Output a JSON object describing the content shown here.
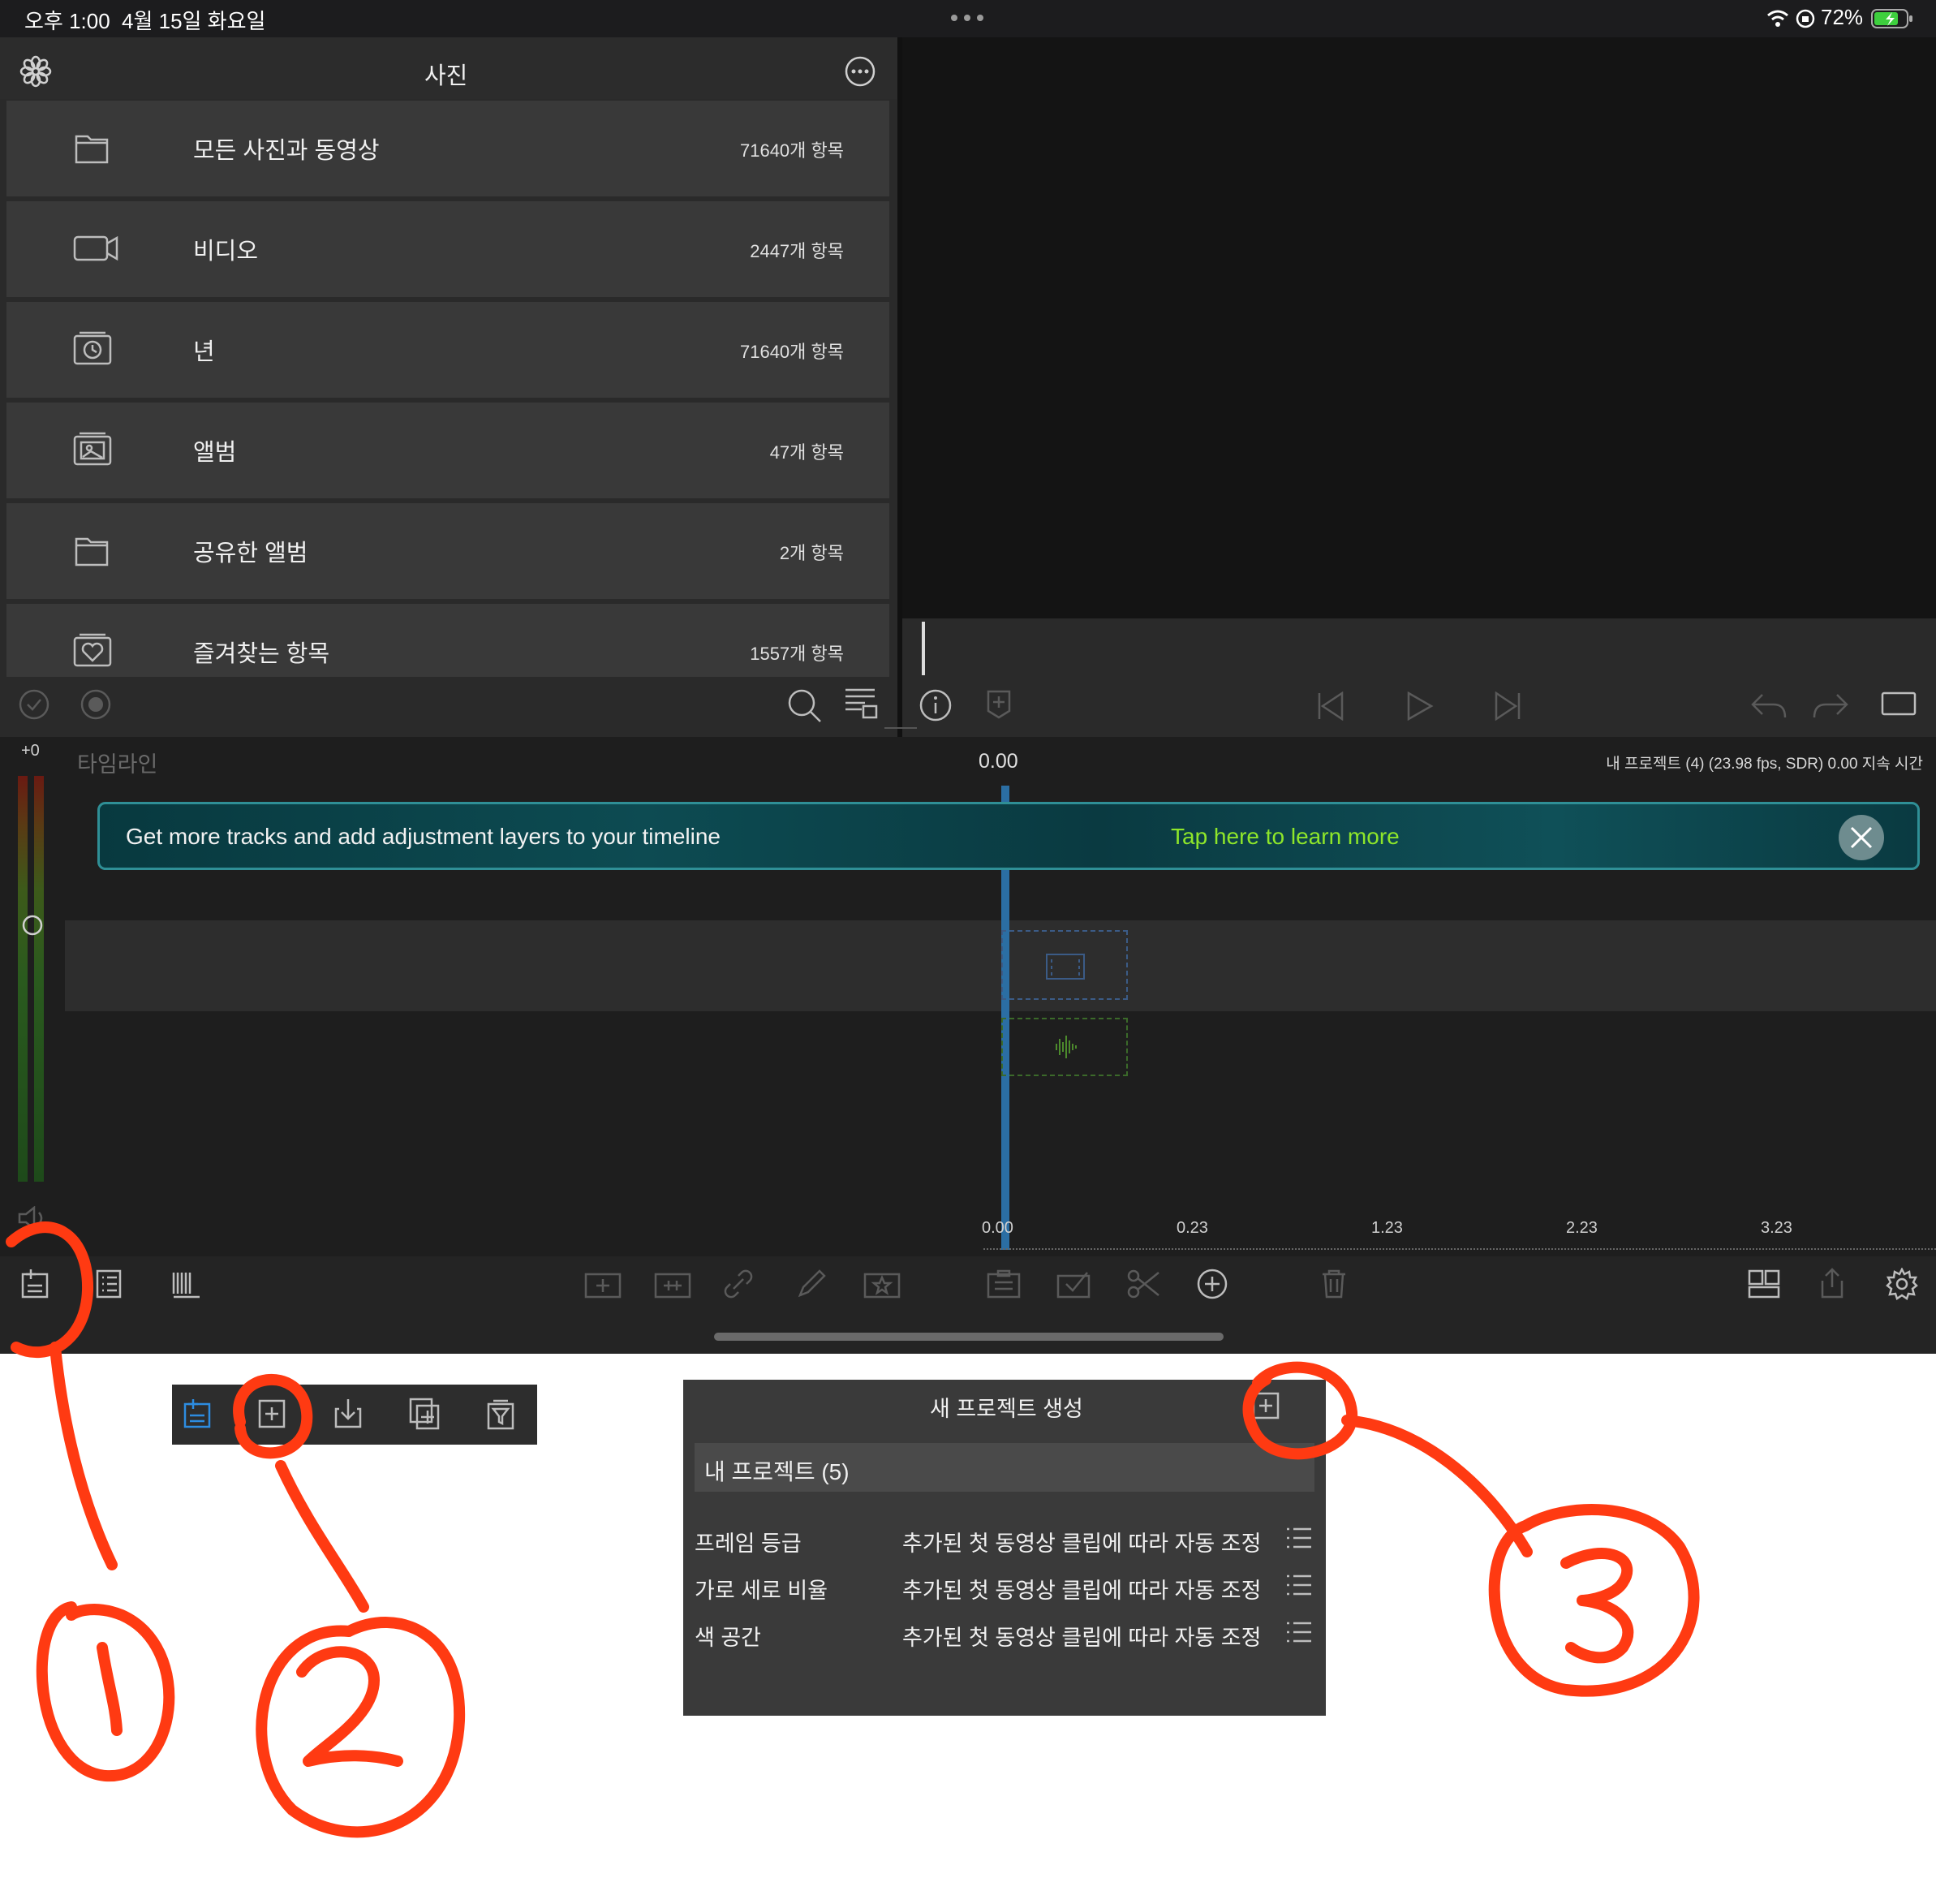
{
  "status_bar": {
    "time": "오후 1:00",
    "date": "4월 15일 화요일",
    "battery": "72%"
  },
  "photos": {
    "title": "사진",
    "items": [
      {
        "label": "모든 사진과 동영상",
        "count": "71640개 항목",
        "icon": "folder-icon"
      },
      {
        "label": "비디오",
        "count": "2447개 항목",
        "icon": "video-icon"
      },
      {
        "label": "년",
        "count": "71640개 항목",
        "icon": "clock-icon"
      },
      {
        "label": "앨범",
        "count": "47개 항목",
        "icon": "album-icon"
      },
      {
        "label": "공유한 앨범",
        "count": "2개 항목",
        "icon": "folder-icon"
      },
      {
        "label": "즐겨찾는 항목",
        "count": "1557개 항목",
        "icon": "heart-icon"
      }
    ]
  },
  "timeline": {
    "label": "타임라인",
    "level": "+0",
    "playhead_time": "0.00",
    "project_info": "내 프로젝트 (4) (23.98 fps, SDR) 0.00 지속 시간",
    "banner_text": "Get more tracks and add adjustment layers to your timeline",
    "banner_link": "Tap here to learn more",
    "ruler_ticks": [
      "0.00",
      "0.23",
      "1.23",
      "2.23",
      "3.23"
    ]
  },
  "dialog": {
    "title": "새 프로젝트 생성",
    "project_name": "내 프로젝트 (5)",
    "rows": [
      {
        "label": "프레임 등급",
        "value": "추가된 첫 동영상 클립에 따라 자동 조정"
      },
      {
        "label": "가로 세로 비율",
        "value": "추가된 첫 동영상 클립에 따라 자동 조정"
      },
      {
        "label": "색 공간",
        "value": "추가된 첫 동영상 클립에 따라 자동 조정"
      }
    ]
  },
  "colors": {
    "annotation": "#ff3a12",
    "link_green": "#8ee62a",
    "playhead_blue": "#2b6ea3",
    "banner_border": "#2f8f96"
  }
}
